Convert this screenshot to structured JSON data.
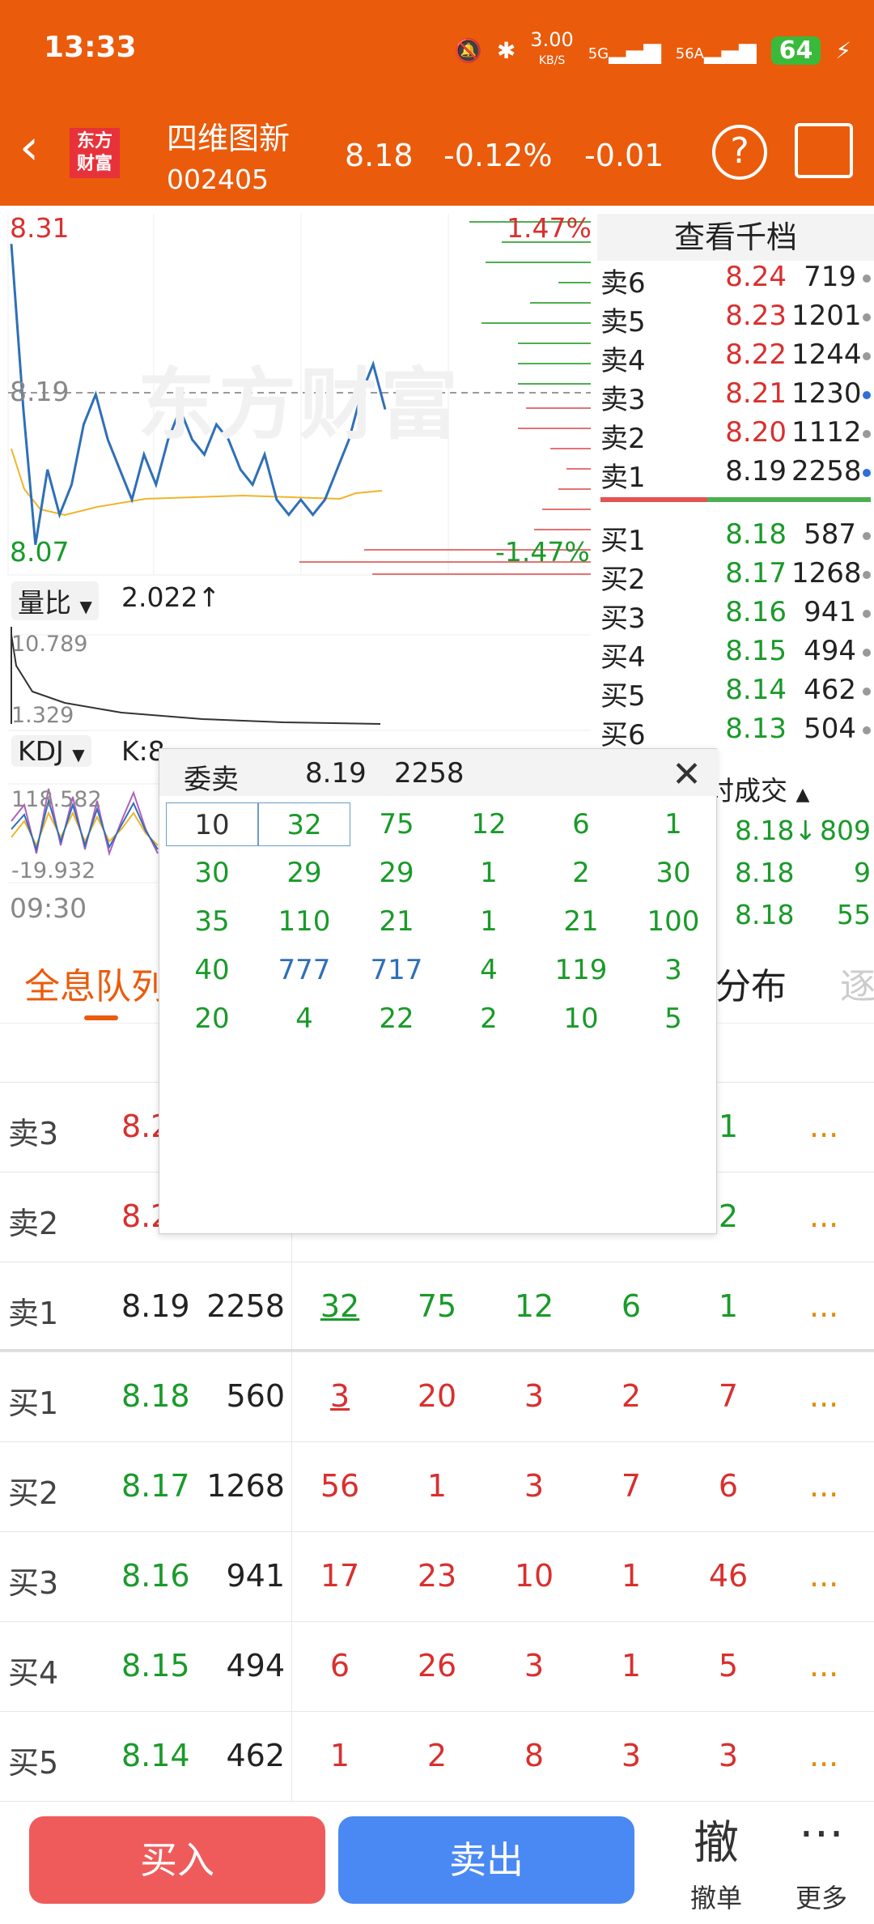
{
  "status_bar": {
    "time": "13:33",
    "speed": "3.00",
    "speed_unit": "KB/S",
    "net1": "5G",
    "net2": "56A",
    "battery": "64"
  },
  "header": {
    "logo_line1": "东方",
    "logo_line2": "财富",
    "name": "四维图新",
    "code": "002405",
    "price": "8.18",
    "change_pct": "-0.12%",
    "change": "-0.01",
    "help": "?"
  },
  "chart": {
    "high": "8.31",
    "low": "8.07",
    "ref_price": "8.19",
    "high_pct": "1.47%",
    "low_pct": "-1.47%",
    "watermark": "东方财富",
    "volume_tag": "量比",
    "volume_ratio": "2.022↑",
    "vol_max": "10.789",
    "vol_min": "1.329",
    "kdj_tag": "KDJ",
    "kdj_k": "K:8",
    "kdj_max": "118.582",
    "kdj_min": "-19.932",
    "start_time": "09:30",
    "price_line": [
      8.29,
      8.18,
      8.09,
      8.14,
      8.11,
      8.13,
      8.17,
      8.19,
      8.16,
      8.14,
      8.12,
      8.15,
      8.13,
      8.16,
      8.18,
      8.16,
      8.15,
      8.17,
      8.16,
      8.14,
      8.13,
      8.15,
      8.12,
      8.11,
      8.12,
      8.11,
      8.12,
      8.14,
      8.16,
      8.19,
      8.21,
      8.18
    ]
  },
  "order_book": {
    "title": "查看千档",
    "asks": [
      {
        "label": "卖6",
        "price": "8.24",
        "vol": "719",
        "dot": "#999999"
      },
      {
        "label": "卖5",
        "price": "8.23",
        "vol": "1201",
        "dot": "#999999"
      },
      {
        "label": "卖4",
        "price": "8.22",
        "vol": "1244",
        "dot": "#999999"
      },
      {
        "label": "卖3",
        "price": "8.21",
        "vol": "1230",
        "dot": "#2f6fd8"
      },
      {
        "label": "卖2",
        "price": "8.20",
        "vol": "1112",
        "dot": "#999999"
      },
      {
        "label": "卖1",
        "price": "8.19",
        "vol": "2258",
        "dot": "#2f6fd8"
      }
    ],
    "bids": [
      {
        "label": "买1",
        "price": "8.18",
        "vol": "587",
        "dot": "#999999"
      },
      {
        "label": "买2",
        "price": "8.17",
        "vol": "1268",
        "dot": "#999999"
      },
      {
        "label": "买3",
        "price": "8.16",
        "vol": "941",
        "dot": "#999999"
      },
      {
        "label": "买4",
        "price": "8.15",
        "vol": "494",
        "dot": "#999999"
      },
      {
        "label": "买5",
        "price": "8.14",
        "vol": "462",
        "dot": "#999999"
      },
      {
        "label": "买6",
        "price": "8.13",
        "vol": "504",
        "dot": "#999999"
      }
    ],
    "ticks_title": "时成交",
    "ticks": [
      {
        "price": "8.18↓",
        "vol": "809"
      },
      {
        "price": "8.18",
        "vol": "9"
      },
      {
        "price": "8.18",
        "vol": "55"
      }
    ]
  },
  "tabs": {
    "full_queue": "全息队列",
    "distribution": "分布",
    "next": "逐"
  },
  "queue": {
    "rows": [
      {
        "label": "卖3",
        "price": "8.21",
        "vol": "",
        "cells": [
          "",
          "",
          "",
          "",
          "1"
        ],
        "more": "...",
        "side": "ask"
      },
      {
        "label": "卖2",
        "price": "8.20",
        "vol": "",
        "cells": [
          "",
          "",
          "",
          "",
          "2"
        ],
        "more": "...",
        "side": "ask"
      },
      {
        "label": "卖1",
        "price": "8.19",
        "vol": "2258",
        "cells": [
          "32",
          "75",
          "12",
          "6",
          "1"
        ],
        "more": "...",
        "side": "ask1"
      },
      {
        "label": "买1",
        "price": "8.18",
        "vol": "560",
        "cells": [
          "3",
          "20",
          "3",
          "2",
          "7"
        ],
        "more": "...",
        "side": "bid"
      },
      {
        "label": "买2",
        "price": "8.17",
        "vol": "1268",
        "cells": [
          "56",
          "1",
          "3",
          "7",
          "6"
        ],
        "more": "...",
        "side": "bid"
      },
      {
        "label": "买3",
        "price": "8.16",
        "vol": "941",
        "cells": [
          "17",
          "23",
          "10",
          "1",
          "46"
        ],
        "more": "...",
        "side": "bid"
      },
      {
        "label": "买4",
        "price": "8.15",
        "vol": "494",
        "cells": [
          "6",
          "26",
          "3",
          "1",
          "5"
        ],
        "more": "...",
        "side": "bid"
      },
      {
        "label": "买5",
        "price": "8.14",
        "vol": "462",
        "cells": [
          "1",
          "2",
          "8",
          "3",
          "3"
        ],
        "more": "...",
        "side": "bid"
      }
    ]
  },
  "popup": {
    "title": "委卖",
    "price": "8.19",
    "vol": "2258",
    "close": "✕",
    "grid": [
      [
        "10",
        "32",
        "75",
        "12",
        "6",
        "1"
      ],
      [
        "30",
        "29",
        "29",
        "1",
        "2",
        "30"
      ],
      [
        "35",
        "110",
        "21",
        "1",
        "21",
        "100"
      ],
      [
        "40",
        "777",
        "717",
        "4",
        "119",
        "3"
      ],
      [
        "20",
        "4",
        "22",
        "2",
        "10",
        "5"
      ]
    ]
  },
  "bottom_bar": {
    "buy": "买入",
    "sell": "卖出",
    "cancel_icon": "撤",
    "cancel": "撤单",
    "more_icon": "⋯",
    "more": "更多"
  }
}
